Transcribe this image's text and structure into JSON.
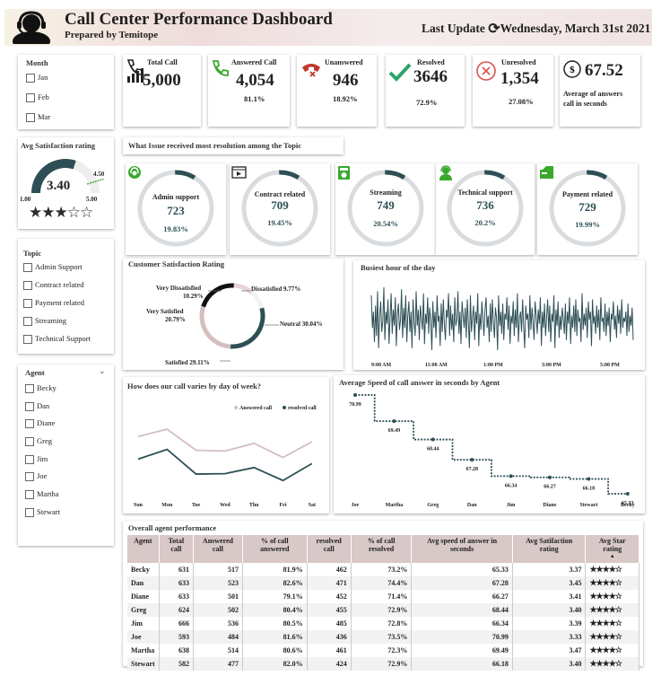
{
  "header": {
    "title": "Call Center Performance Dashboard",
    "subtitle": "Prepared by Temitope",
    "last_update_label": "Last Update",
    "last_update_date": "Wednesday, March 31st 2021"
  },
  "colors": {
    "accent": "#2d4f55",
    "soft": "#d4bfbf",
    "header_bg": "#f0e4e3"
  },
  "filters": {
    "month_title": "Month",
    "months": [
      "Jan",
      "Feb",
      "Mar"
    ],
    "topic_title": "Topic",
    "topics": [
      "Admin Support",
      "Contract related",
      "Payment related",
      "Streaming",
      "Technical Support"
    ],
    "agent_title": "Agent",
    "agents": [
      "Becky",
      "Dan",
      "Diane",
      "Greg",
      "Jim",
      "Joe",
      "Martha",
      "Stewart"
    ]
  },
  "kpis": {
    "total": {
      "label": "Total Call",
      "value": "5,000"
    },
    "answered": {
      "label": "Answered Call",
      "value": "4,054",
      "pct": "81.1%"
    },
    "unanswered": {
      "label": "Unanswered",
      "value": "946",
      "pct": "18.92%"
    },
    "resolved": {
      "label": "Resolved",
      "value": "3646",
      "pct": "72.9%"
    },
    "unresolved": {
      "label": "Unresolved",
      "value": "1,354",
      "pct": "27.08%"
    },
    "avg_answer": {
      "value": "67.52",
      "label_line1": "Average of answers",
      "label_line2": "call in seconds"
    }
  },
  "satisfaction_gauge": {
    "title": "Avg Satisfaction rating",
    "value": "3.40",
    "value_num": 3.4,
    "min": "1.00",
    "max": "5.00",
    "target": "4.50",
    "min_num": 1,
    "max_num": 5,
    "stars": "★★★☆☆"
  },
  "topics_section": {
    "title": "What Issue received most resolution among the Topic",
    "items": [
      {
        "name": "Admin support",
        "value": "723",
        "pct": "19.83%",
        "frac": 0.92,
        "icon": "headset-icon"
      },
      {
        "name": "Contract related",
        "value": "709",
        "pct": "19.45%",
        "frac": 0.9,
        "icon": "video-icon"
      },
      {
        "name": "Streaming",
        "value": "749",
        "pct": "20.54%",
        "frac": 0.95,
        "icon": "media-icon"
      },
      {
        "name": "Technical support",
        "value": "736",
        "pct": "20.2%",
        "frac": 0.94,
        "icon": "support-agent-icon"
      },
      {
        "name": "Payment related",
        "value": "729",
        "pct": "19.99%",
        "frac": 0.93,
        "icon": "payment-icon"
      }
    ]
  },
  "chart_data": [
    {
      "type": "pie",
      "title": "Customer Satisfaction Rating",
      "labels": [
        "Very Dissatisfied",
        "Dissatisfied",
        "Neutral",
        "Satisfied",
        "Very Satisfied"
      ],
      "values": [
        10.29,
        9.77,
        30.04,
        29.11,
        20.79
      ],
      "value_labels": [
        "10.29%",
        "9.77%",
        "30.04%",
        "29.11%",
        "20.79%"
      ],
      "colors": [
        "#e8d4d4",
        "#f2f2f2",
        "#2d4f55",
        "#d4bfbf",
        "#111111"
      ]
    },
    {
      "type": "line",
      "title": "Busiest hour of the day",
      "x_ticks": [
        "9:00 AM",
        "11:00 AM",
        "1:00 PM",
        "3:00 PM",
        "5:00 PM"
      ],
      "values": [
        38,
        22,
        30,
        15,
        33,
        18,
        40,
        12,
        28,
        35,
        20,
        25,
        42,
        16,
        30,
        24,
        36,
        14,
        27,
        39,
        19,
        31,
        23,
        37,
        13,
        29,
        34,
        21,
        26,
        41,
        17,
        32,
        22,
        38,
        15,
        28,
        35,
        20,
        30,
        12,
        36,
        25,
        18,
        40,
        23,
        31,
        16,
        33,
        27,
        21,
        39,
        14,
        29,
        24,
        37,
        19,
        32,
        26,
        11,
        35,
        22,
        30,
        17,
        38,
        25,
        28,
        13,
        34,
        20,
        36,
        24,
        16,
        31,
        27,
        39,
        18,
        33,
        21,
        29,
        15,
        37,
        23,
        26,
        40,
        19,
        30,
        14,
        35,
        28,
        22,
        32,
        17,
        36,
        25,
        12,
        38,
        20,
        27,
        33,
        16,
        30,
        24,
        39,
        13,
        29,
        21,
        35,
        26,
        18,
        31,
        37,
        22,
        28,
        15,
        34,
        20,
        36,
        25,
        17,
        32,
        27,
        11,
        38,
        23,
        30,
        19,
        34,
        16,
        29,
        26,
        37,
        21,
        33,
        14,
        28,
        24,
        35,
        18,
        31,
        22,
        39,
        15,
        27,
        30,
        20,
        36,
        23,
        12,
        33,
        26,
        29,
        17,
        38,
        21,
        32,
        25,
        16,
        35,
        28,
        19,
        31,
        24,
        37,
        13,
        30,
        22,
        34,
        18,
        27,
        36,
        20,
        33,
        15,
        29,
        25,
        38,
        12,
        31,
        23,
        35,
        17,
        28,
        21,
        32,
        26,
        19,
        34,
        16,
        30,
        24,
        37,
        14,
        28,
        22,
        33,
        20,
        36,
        18,
        31,
        25,
        27,
        15,
        39,
        21,
        29,
        23,
        32,
        17,
        35,
        26,
        30,
        13,
        36,
        24,
        28,
        19,
        33,
        22,
        31,
        16,
        37,
        25,
        27,
        20,
        34,
        18,
        30,
        23,
        32,
        15,
        29,
        26,
        35,
        21,
        28,
        17,
        33,
        24,
        31,
        19,
        36,
        22,
        27,
        25,
        30,
        18,
        34,
        20,
        28,
        23,
        32,
        16
      ]
    },
    {
      "type": "line",
      "title": "How does our call varies by day of week?",
      "categories": [
        "Sun",
        "Mon",
        "Tue",
        "Wed",
        "Thu",
        "Fri",
        "Sat"
      ],
      "series": [
        {
          "name": "Answered call",
          "values": [
            604,
            622,
            570,
            568,
            587,
            552,
            591
          ],
          "color": "#d4bfbf"
        },
        {
          "name": "resolved call",
          "values": [
            548,
            572,
            511,
            512,
            527,
            495,
            537
          ],
          "color": "#2d4f55"
        }
      ]
    },
    {
      "type": "line",
      "title": "Average Speed of call answer in seconds by Agent",
      "categories": [
        "Joe",
        "Martha",
        "Greg",
        "Dan",
        "Jim",
        "Diane",
        "Stewart",
        "Becky"
      ],
      "values": [
        70.99,
        69.49,
        68.44,
        67.28,
        66.34,
        66.27,
        66.18,
        65.33
      ],
      "value_labels": [
        "70.99",
        "69.49",
        "68.44",
        "67.28",
        "66.34",
        "66.27",
        "66.18",
        "65.33"
      ]
    },
    {
      "type": "table",
      "title": "Overall agent performance",
      "columns": [
        "Agent",
        "Total call",
        "Answered call",
        "% of call answered",
        "resolved call",
        "% of call resolved",
        "Avg speed of answer in seconds",
        "Avg Satifaction rating",
        "Avg Star rating"
      ],
      "rows": [
        [
          "Becky",
          "631",
          "517",
          "81.9%",
          "462",
          "73.2%",
          "65.33",
          "3.37",
          "★★★★☆"
        ],
        [
          "Dan",
          "633",
          "523",
          "82.6%",
          "471",
          "74.4%",
          "67.28",
          "3.45",
          "★★★★☆"
        ],
        [
          "Diane",
          "633",
          "501",
          "79.1%",
          "452",
          "71.4%",
          "66.27",
          "3.41",
          "★★★★☆"
        ],
        [
          "Greg",
          "624",
          "502",
          "80.4%",
          "455",
          "72.9%",
          "68.44",
          "3.40",
          "★★★★☆"
        ],
        [
          "Jim",
          "666",
          "536",
          "80.5%",
          "485",
          "72.8%",
          "66.34",
          "3.39",
          "★★★★☆"
        ],
        [
          "Joe",
          "593",
          "484",
          "81.6%",
          "436",
          "73.5%",
          "70.99",
          "3.33",
          "★★★★☆"
        ],
        [
          "Martha",
          "638",
          "514",
          "80.6%",
          "461",
          "72.3%",
          "69.49",
          "3.47",
          "★★★★☆"
        ],
        [
          "Stewart",
          "582",
          "477",
          "82.0%",
          "424",
          "72.9%",
          "66.18",
          "3.40",
          "★★★★☆"
        ]
      ],
      "sort_indicator": "▲"
    }
  ]
}
